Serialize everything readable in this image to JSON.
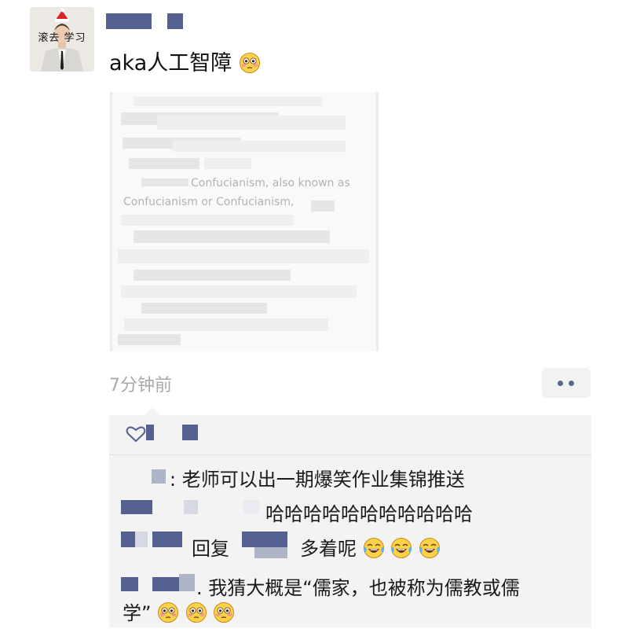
{
  "avatar": {
    "caption": "滚去  学习"
  },
  "post": {
    "text": "aka人工智障",
    "emoji_icon": "flushed-face-icon",
    "image_text": [
      "Confucianism, also known as",
      "Confucianism or Confucianism,"
    ],
    "time": "7分钟前"
  },
  "comments": [
    {
      "text": ": 老师可以出一期爆笑作业集锦推送"
    },
    {
      "text": "哈哈哈哈哈哈哈哈哈哈哈"
    },
    {
      "reply_label": "回复",
      "text": "多着呢",
      "emoji_icon": "tears-of-joy-icon",
      "emoji_count": 3
    },
    {
      "text_line1": ". 我猜大概是“儒家，也被称为儒教或儒",
      "text_line2": "学”",
      "emoji_icon": "flushed-face-icon",
      "emoji_count": 3
    }
  ],
  "colors": {
    "link": "#54608f",
    "panel": "#f3f3f3",
    "time": "#a9a9a9"
  }
}
